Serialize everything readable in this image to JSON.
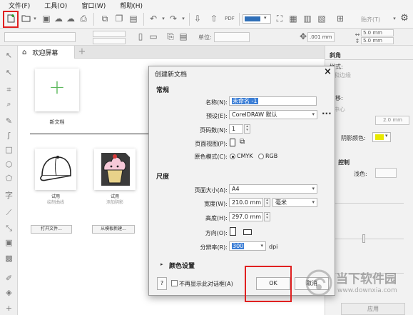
{
  "menu": [
    "文件(F)",
    "工具(O)",
    "窗口(W)",
    "帮助(H)"
  ],
  "toolbar": {
    "zoom_value": "",
    "snap_label": "贴齐(T)"
  },
  "propbar": {
    "unit_label": "单位:",
    "nudge_value": ".001 mm",
    "dup_x": "5.0 mm",
    "dup_y": "5.0 mm"
  },
  "tabs": {
    "welcome": "欢迎屏幕"
  },
  "welcome": {
    "new_doc": "新文档",
    "templates": [
      {
        "title": "试用",
        "sub": "绘制曲线"
      },
      {
        "title": "试用",
        "sub": "添加阴影"
      }
    ],
    "open_file": "打开文件...",
    "new_from_template": "从模板新建..."
  },
  "docker": {
    "title": "斜角",
    "style_label": "样式:",
    "edge_label": "和边缘",
    "offset_label": "偏移:",
    "center_label": "中心",
    "distance_value": "2.0 mm",
    "shadow_color_label": "阴影颜色:",
    "shadow_color": "#e8e800",
    "control_label": "控制",
    "light_label": "浅色:",
    "apply": "应用"
  },
  "dialog": {
    "title": "创建新文档",
    "sections": {
      "general": "常规",
      "size": "尺度",
      "color": "颜色设置"
    },
    "name_label": "名称(N):",
    "name_value": "未命名 -1",
    "preset_label": "预设(E):",
    "preset_value": "CorelDRAW 默认",
    "pages_label": "页码数(N):",
    "pages_value": "1",
    "page_view_label": "页面视图(P):",
    "color_mode_label": "原色模式(C):",
    "color_mode_cmyk": "CMYK",
    "color_mode_rgb": "RGB",
    "page_size_label": "页面大小(A):",
    "page_size_value": "A4",
    "width_label": "宽度(W):",
    "width_value": "210.0 mm",
    "unit_value": "毫米",
    "height_label": "高度(H):",
    "height_value": "297.0 mm",
    "orientation_label": "方向(O):",
    "resolution_label": "分辨率(R):",
    "resolution_value": "300",
    "resolution_unit": "dpi",
    "dont_show": "不再显示此对话框(A)",
    "help": "?",
    "ok": "OK",
    "cancel": "取消"
  },
  "watermark": {
    "brand": "当下软件园",
    "url": "www.downxia.com"
  }
}
